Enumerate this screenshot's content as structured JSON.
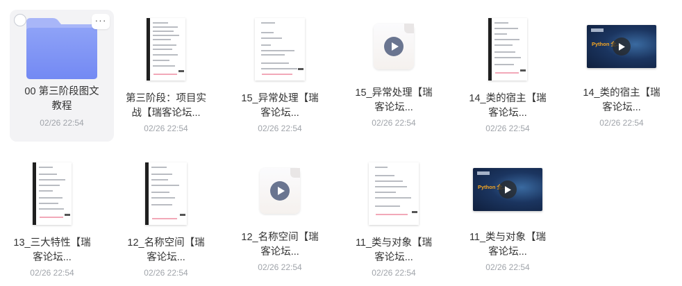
{
  "files": [
    {
      "name": "00 第三阶段图文教程",
      "lines": [
        "00 第三阶段图文",
        "教程"
      ],
      "date": "02/26 22:54",
      "type": "folder",
      "selected": true
    },
    {
      "name": "第三阶段：项目实战【瑞客论坛...",
      "lines": [
        "第三阶段：项目实",
        "战【瑞客论坛..."
      ],
      "date": "02/26 22:54",
      "type": "doc"
    },
    {
      "name": "15_异常处理【瑞客论坛...",
      "lines": [
        "15_异常处理【瑞",
        "客论坛..."
      ],
      "date": "02/26 22:54",
      "type": "doc"
    },
    {
      "name": "15_异常处理【瑞客论坛...",
      "lines": [
        "15_异常处理【瑞",
        "客论坛..."
      ],
      "date": "02/26 22:54",
      "type": "video-file"
    },
    {
      "name": "14_类的宿主【瑞客论坛...",
      "lines": [
        "14_类的宿主【瑞",
        "客论坛..."
      ],
      "date": "02/26 22:54",
      "type": "doc"
    },
    {
      "name": "14_类的宿主【瑞客论坛...",
      "lines": [
        "14_类的宿主【瑞",
        "客论坛..."
      ],
      "date": "02/26 22:54",
      "type": "video-thumb",
      "thumb_text": "Python 全..."
    },
    {
      "name": "13_三大特性【瑞客论坛...",
      "lines": [
        "13_三大特性【瑞",
        "客论坛..."
      ],
      "date": "02/26 22:54",
      "type": "doc"
    },
    {
      "name": "12_名称空间【瑞客论坛...",
      "lines": [
        "12_名称空间【瑞",
        "客论坛..."
      ],
      "date": "02/26 22:54",
      "type": "doc"
    },
    {
      "name": "12_名称空间【瑞客论坛...",
      "lines": [
        "12_名称空间【瑞",
        "客论坛..."
      ],
      "date": "02/26 22:54",
      "type": "video-file"
    },
    {
      "name": "11_类与对象【瑞客论坛...",
      "lines": [
        "11_类与对象【瑞",
        "客论坛..."
      ],
      "date": "02/26 22:54",
      "type": "doc"
    },
    {
      "name": "11_类与对象【瑞客论坛...",
      "lines": [
        "11_类与对象【瑞",
        "客论坛..."
      ],
      "date": "02/26 22:54",
      "type": "video-thumb",
      "thumb_text": "Python 全..."
    }
  ],
  "icons": {
    "folder": "folder-icon",
    "checkbox": "select-checkbox",
    "more": "more-options-icon",
    "play": "play-icon"
  },
  "more_label": "···",
  "colors": {
    "folder_top": "#8ea2f7",
    "folder_bottom": "#7389f3",
    "selected_bg": "#f3f3f5",
    "play": "#6a7590",
    "date": "#a0a4aa"
  }
}
